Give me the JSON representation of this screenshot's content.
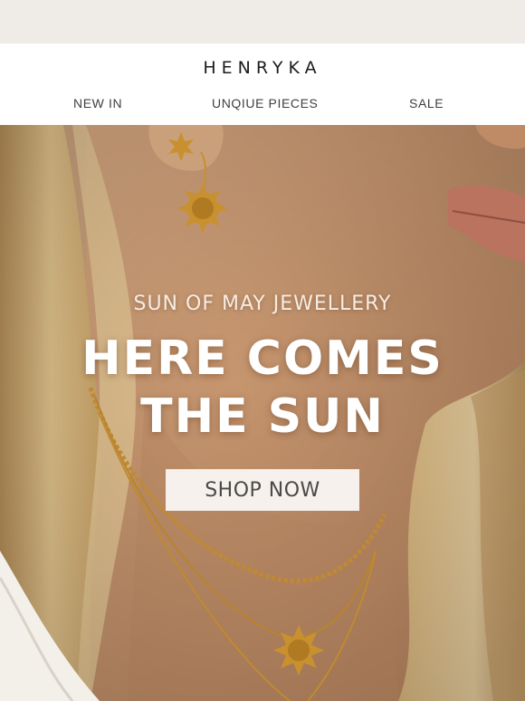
{
  "brand": {
    "logo": "HENRYKA"
  },
  "nav": {
    "items": [
      {
        "label": "NEW IN"
      },
      {
        "label": "UNQIUE PIECES"
      },
      {
        "label": "SALE"
      }
    ]
  },
  "hero": {
    "eyebrow": "SUN OF MAY JEWELLERY",
    "headline_line1": "HERE COMES",
    "headline_line2": "THE SUN",
    "cta_label": "SHOP NOW"
  },
  "colors": {
    "page_band": "#efebe6",
    "header_bg": "#ffffff",
    "skin": "#c99a74",
    "hair": "#d6b27a",
    "gold": "#c8902e",
    "cta_bg": "#f6f1ec"
  }
}
